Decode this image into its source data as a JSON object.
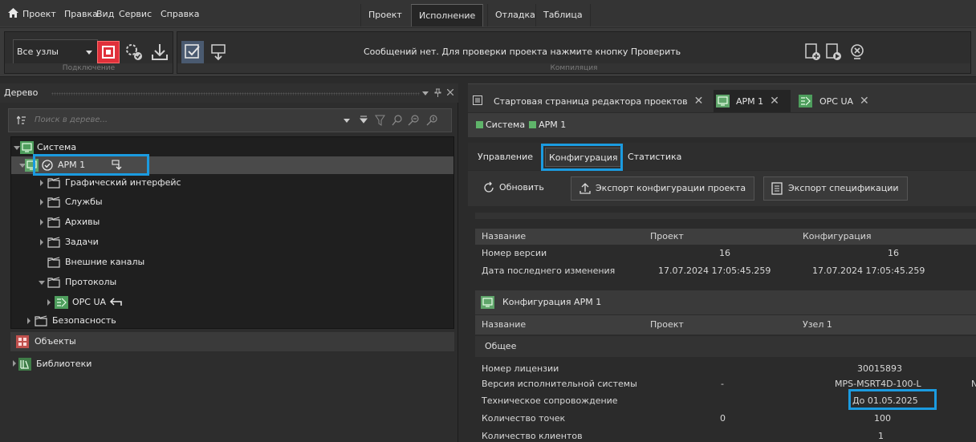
{
  "menu": {
    "items": [
      "Проект",
      "Правка",
      "Вид",
      "Сервис",
      "Справка"
    ],
    "ribbon_tabs": [
      "Проект",
      "Исполнение",
      "Отладка",
      "Таблица"
    ],
    "active_ribbon_tab": "Исполнение"
  },
  "toolbar": {
    "nodes_select": "Все узлы",
    "group_connection": "Подключение",
    "group_compile": "Компиляция",
    "message": "Сообщений нет. Для проверки проекта нажмите кнопку Проверить"
  },
  "tree_panel": {
    "title": "Дерево",
    "search_placeholder": "Поиск в дереве...",
    "root": "Система",
    "node": "АРМ 1",
    "items": [
      "Графический интерфейс",
      "Службы",
      "Архивы",
      "Задачи",
      "Внешние каналы",
      "Протоколы"
    ],
    "protocol_child": "OPC UA",
    "security": "Безопасность",
    "objects": "Объекты",
    "libraries": "Библиотеки"
  },
  "doc_tabs": [
    {
      "label": "Стартовая страница редактора проектов"
    },
    {
      "label": "АРМ 1"
    },
    {
      "label": "OPC UA"
    }
  ],
  "breadcrumb": {
    "first": "Система",
    "second": "АРМ 1"
  },
  "sub_tabs": [
    "Управление",
    "Конфигурация",
    "Статистика"
  ],
  "buttons": {
    "refresh": "Обновить",
    "export_config": "Экспорт конфигурации проекта",
    "export_spec": "Экспорт спецификации"
  },
  "version_table": {
    "headers": [
      "Название",
      "Проект",
      "Конфигурация"
    ],
    "rows": [
      {
        "name": "Номер версии",
        "project": "16",
        "config": "16"
      },
      {
        "name": "Дата последнего изменения",
        "project": "17.07.2024 17:05:45.259",
        "config": "17.07.2024 17:05:45.259"
      }
    ]
  },
  "config_table": {
    "title": "Конфигурация АРМ 1",
    "headers": [
      "Название",
      "Проект",
      "Узел 1"
    ],
    "section": "Общее",
    "rows": [
      {
        "name": "Номер лицензии",
        "project": "",
        "node": "30015893"
      },
      {
        "name": "Версия исполнительной системы",
        "project": "-",
        "node": "MPS-MSRT4D-100-L"
      },
      {
        "name": "Техническое сопровождение",
        "project": "",
        "node": "До 01.05.2025"
      },
      {
        "name": "Количество точек",
        "project": "0",
        "node": "100"
      },
      {
        "name": "Количество клиентов",
        "project": "",
        "node": "1"
      }
    ],
    "overflow_char": "N"
  },
  "colors": {
    "highlight": "#1b9be0",
    "node_green": "#5fa56a",
    "stop_red": "#e0303a"
  }
}
